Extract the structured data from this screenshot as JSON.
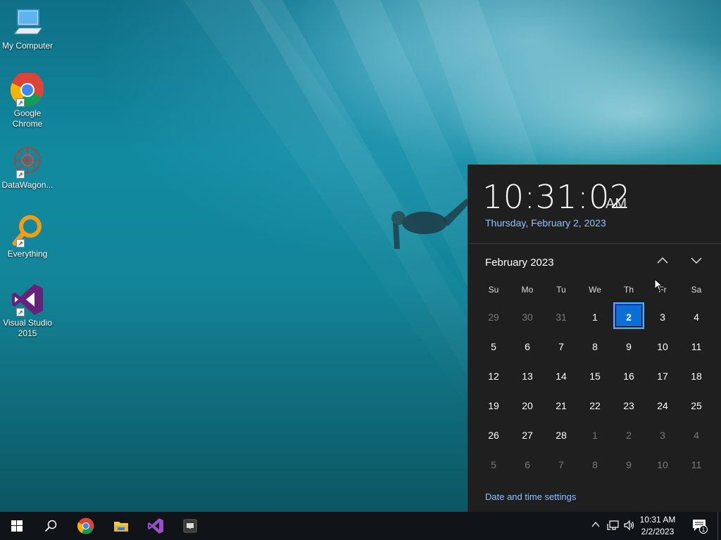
{
  "desktop": {
    "icons": [
      {
        "label": "My Computer",
        "icon": "computer-icon"
      },
      {
        "label": "Google Chrome",
        "icon": "chrome-icon"
      },
      {
        "label": "DataWagon...",
        "icon": "datawagon-icon"
      },
      {
        "label": "Everything",
        "icon": "everything-icon"
      },
      {
        "label": "Visual Studio 2015",
        "icon": "visual-studio-icon"
      }
    ]
  },
  "flyout": {
    "time": "10:31:02",
    "ampm": "AM",
    "date_full": "Thursday, February 2, 2023",
    "month_label": "February 2023",
    "weekdays": [
      "Su",
      "Mo",
      "Tu",
      "We",
      "Th",
      "Fr",
      "Sa"
    ],
    "weeks": [
      [
        {
          "d": "29",
          "dim": true
        },
        {
          "d": "30",
          "dim": true
        },
        {
          "d": "31",
          "dim": true
        },
        {
          "d": "1"
        },
        {
          "d": "2",
          "today": true
        },
        {
          "d": "3"
        },
        {
          "d": "4"
        }
      ],
      [
        {
          "d": "5"
        },
        {
          "d": "6"
        },
        {
          "d": "7"
        },
        {
          "d": "8"
        },
        {
          "d": "9"
        },
        {
          "d": "10"
        },
        {
          "d": "11"
        }
      ],
      [
        {
          "d": "12"
        },
        {
          "d": "13"
        },
        {
          "d": "14"
        },
        {
          "d": "15"
        },
        {
          "d": "16"
        },
        {
          "d": "17"
        },
        {
          "d": "18"
        }
      ],
      [
        {
          "d": "19"
        },
        {
          "d": "20"
        },
        {
          "d": "21"
        },
        {
          "d": "22"
        },
        {
          "d": "23"
        },
        {
          "d": "24"
        },
        {
          "d": "25"
        }
      ],
      [
        {
          "d": "26"
        },
        {
          "d": "27"
        },
        {
          "d": "28"
        },
        {
          "d": "1",
          "dim": true
        },
        {
          "d": "2",
          "dim": true
        },
        {
          "d": "3",
          "dim": true
        },
        {
          "d": "4",
          "dim": true
        }
      ],
      [
        {
          "d": "5",
          "dim": true
        },
        {
          "d": "6",
          "dim": true
        },
        {
          "d": "7",
          "dim": true
        },
        {
          "d": "8",
          "dim": true
        },
        {
          "d": "9",
          "dim": true
        },
        {
          "d": "10",
          "dim": true
        },
        {
          "d": "11",
          "dim": true
        }
      ]
    ],
    "settings_link": "Date and time settings",
    "accent_color": "#0a6fd6"
  },
  "taskbar": {
    "apps": [
      "start-icon",
      "search-icon",
      "chrome-icon",
      "file-explorer-icon",
      "visual-studio-icon",
      "app-icon"
    ],
    "tray": {
      "time": "10:31 AM",
      "date": "2/2/2023",
      "notification_count": "1"
    }
  }
}
